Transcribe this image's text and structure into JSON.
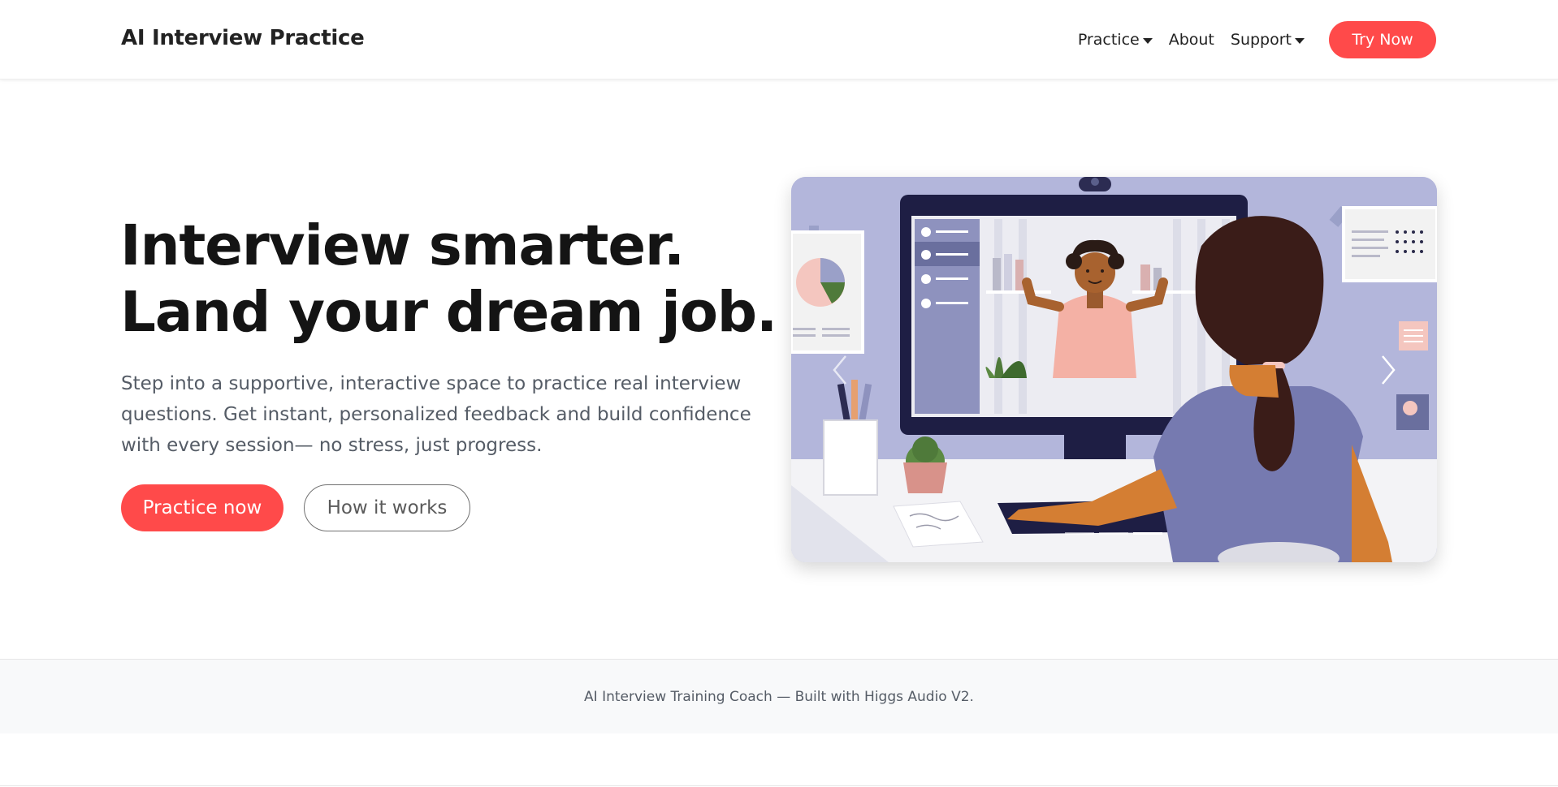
{
  "brand": "AI Interview Practice",
  "nav": {
    "items": [
      {
        "label": "Practice",
        "dropdown": true
      },
      {
        "label": "About",
        "dropdown": false
      },
      {
        "label": "Support",
        "dropdown": true
      }
    ],
    "cta_label": "Try Now"
  },
  "hero": {
    "title_line1": "Interview smarter.",
    "title_line2": "Land your dream job.",
    "description": "Step into a supportive, interactive space to practice real interview questions. Get instant, personalized feedback and build confidence with every session— no stress, just progress.",
    "primary_label": "Practice now",
    "secondary_label": "How it works"
  },
  "carousel": {
    "slide_icon": "video-interview-illustration",
    "prev_icon": "chevron-left-icon",
    "next_icon": "chevron-right-icon",
    "indicator_count": 3,
    "active_index": 2
  },
  "footer": {
    "text": "AI Interview Training Coach — Built with Higgs Audio V2."
  },
  "colors": {
    "accent": "#ff4a4a",
    "text_dark": "#141414",
    "text_muted": "#555c66",
    "footer_bg": "#f8f9fa",
    "illustration_bg": "#b3b6db"
  }
}
